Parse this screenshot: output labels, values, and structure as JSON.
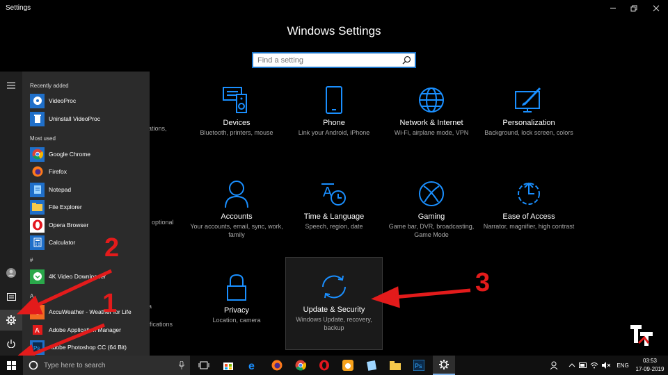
{
  "window": {
    "title": "Settings"
  },
  "settings": {
    "heading": "Windows Settings",
    "search_placeholder": "Find a setting",
    "tiles": [
      {
        "name": "Devices",
        "desc": "Bluetooth, printers, mouse",
        "icon": "devices-icon"
      },
      {
        "name": "Phone",
        "desc": "Link your Android, iPhone",
        "icon": "phone-icon"
      },
      {
        "name": "Network & Internet",
        "desc": "Wi-Fi, airplane mode, VPN",
        "icon": "globe-icon"
      },
      {
        "name": "Personalization",
        "desc": "Background, lock screen, colors",
        "icon": "paint-icon"
      },
      {
        "name": "Accounts",
        "desc": "Your accounts, email, sync, work, family",
        "icon": "person-icon"
      },
      {
        "name": "Time & Language",
        "desc": "Speech, region, date",
        "icon": "time-language-icon"
      },
      {
        "name": "Gaming",
        "desc": "Game bar, DVR, broadcasting, Game Mode",
        "icon": "xbox-icon"
      },
      {
        "name": "Ease of Access",
        "desc": "Narrator, magnifier, high contrast",
        "icon": "ease-of-access-icon"
      },
      {
        "name": "Privacy",
        "desc": "Location, camera",
        "icon": "lock-icon"
      },
      {
        "name": "Update & Security",
        "desc": "Windows Update, recovery, backup",
        "icon": "sync-icon"
      }
    ],
    "partials": [
      "ations,",
      ", optional",
      "a",
      "ifications"
    ]
  },
  "start_menu": {
    "recently_added_label": "Recently added",
    "most_used_label": "Most used",
    "hash_label": "#",
    "a_label": "A",
    "recent": [
      "VideoProc",
      "Uninstall VideoProc"
    ],
    "most_used": [
      "Google Chrome",
      "Firefox",
      "Notepad",
      "File Explorer",
      "Opera Browser",
      "Calculator"
    ],
    "hash_apps": [
      "4K Video Downloader"
    ],
    "a_apps": [
      "AccuWeather - Weather for Life",
      "Adobe Application Manager",
      "Adobe Photoshop CC (64 Bit)"
    ]
  },
  "annotations": {
    "n1": "1",
    "n2": "2",
    "n3": "3"
  },
  "taskbar": {
    "search_placeholder": "Type here to search",
    "language": "ENG",
    "time": "03:53",
    "date": "17-09-2019"
  },
  "colors": {
    "accent": "#1a8fff",
    "arrow": "#e31b1b"
  }
}
